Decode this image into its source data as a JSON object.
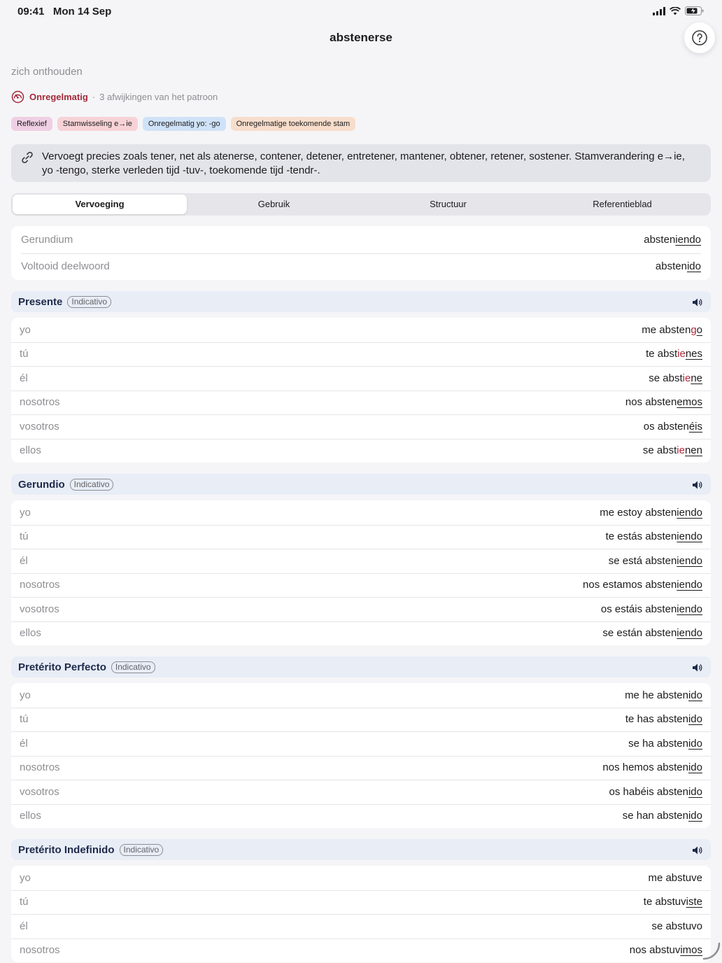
{
  "status": {
    "time": "09:41",
    "date": "Mon 14 Sep"
  },
  "nav": {
    "title": "abstenerse"
  },
  "translation": "zich onthouden",
  "irregularity": {
    "label": "Onregelmatig",
    "separator": "·",
    "description": "3 afwijkingen van het patroon"
  },
  "tags": [
    {
      "label": "Reflexief",
      "color": "#efcfe3"
    },
    {
      "label": "Stamwisseling e→ie",
      "color": "#f7d2d6"
    },
    {
      "label": "Onregelmatig yo: -go",
      "color": "#cfe2f7"
    },
    {
      "label": "Onregelmatige toekomende stam",
      "color": "#f7ddcb"
    }
  ],
  "info_text": "Vervoegt precies zoals tener, net als atenerse, contener, detener, entretener, mantener, obtener, retener, sostener. Stamverandering e→ie, yo -tengo, sterke verleden tijd -tuv-, toekomende tijd -tendr-.",
  "tabs": [
    "Vervoeging",
    "Gebruik",
    "Structuur",
    "Referentieblad"
  ],
  "nonfinite": [
    {
      "label": "Gerundium",
      "stem": "absten",
      "ending": "iendo"
    },
    {
      "label": "Voltooid deelwoord",
      "stem": "absten",
      "ending": "ido"
    }
  ],
  "tenses": [
    {
      "name": "Presente",
      "mood": "Indicativo",
      "rows": [
        {
          "pronoun": "yo",
          "pre": "me absten",
          "change": "g",
          "ending": "o"
        },
        {
          "pronoun": "tú",
          "pre": "te abst",
          "change": "ie",
          "ending": "nes"
        },
        {
          "pronoun": "él",
          "pre": "se abst",
          "change": "ie",
          "ending": "ne"
        },
        {
          "pronoun": "nosotros",
          "pre": "nos absten",
          "change": "",
          "ending": "emos"
        },
        {
          "pronoun": "vosotros",
          "pre": "os absten",
          "change": "",
          "ending": "éis"
        },
        {
          "pronoun": "ellos",
          "pre": "se abst",
          "change": "ie",
          "ending": "nen"
        }
      ]
    },
    {
      "name": "Gerundio",
      "mood": "Indicativo",
      "rows": [
        {
          "pronoun": "yo",
          "pre": "me estoy absten",
          "change": "",
          "ending": "iendo"
        },
        {
          "pronoun": "tú",
          "pre": "te estás absten",
          "change": "",
          "ending": "iendo"
        },
        {
          "pronoun": "él",
          "pre": "se está absten",
          "change": "",
          "ending": "iendo"
        },
        {
          "pronoun": "nosotros",
          "pre": "nos estamos absten",
          "change": "",
          "ending": "iendo"
        },
        {
          "pronoun": "vosotros",
          "pre": "os estáis absten",
          "change": "",
          "ending": "iendo"
        },
        {
          "pronoun": "ellos",
          "pre": "se están absten",
          "change": "",
          "ending": "iendo"
        }
      ]
    },
    {
      "name": "Pretérito Perfecto",
      "mood": "Indicativo",
      "rows": [
        {
          "pronoun": "yo",
          "pre": "me he absten",
          "change": "",
          "ending": "ido"
        },
        {
          "pronoun": "tú",
          "pre": "te has absten",
          "change": "",
          "ending": "ido"
        },
        {
          "pronoun": "él",
          "pre": "se ha absten",
          "change": "",
          "ending": "ido"
        },
        {
          "pronoun": "nosotros",
          "pre": "nos hemos absten",
          "change": "",
          "ending": "ido"
        },
        {
          "pronoun": "vosotros",
          "pre": "os habéis absten",
          "change": "",
          "ending": "ido"
        },
        {
          "pronoun": "ellos",
          "pre": "se han absten",
          "change": "",
          "ending": "ido"
        }
      ]
    },
    {
      "name": "Pretérito Indefinido",
      "mood": "Indicativo",
      "rows": [
        {
          "pronoun": "yo",
          "pre": "me abstuve",
          "change": "",
          "ending": ""
        },
        {
          "pronoun": "tú",
          "pre": "te abstuv",
          "change": "",
          "ending": "iste"
        },
        {
          "pronoun": "él",
          "pre": "se abstuvo",
          "change": "",
          "ending": ""
        },
        {
          "pronoun": "nosotros",
          "pre": "nos abstuv",
          "change": "",
          "ending": "imos"
        }
      ]
    }
  ]
}
